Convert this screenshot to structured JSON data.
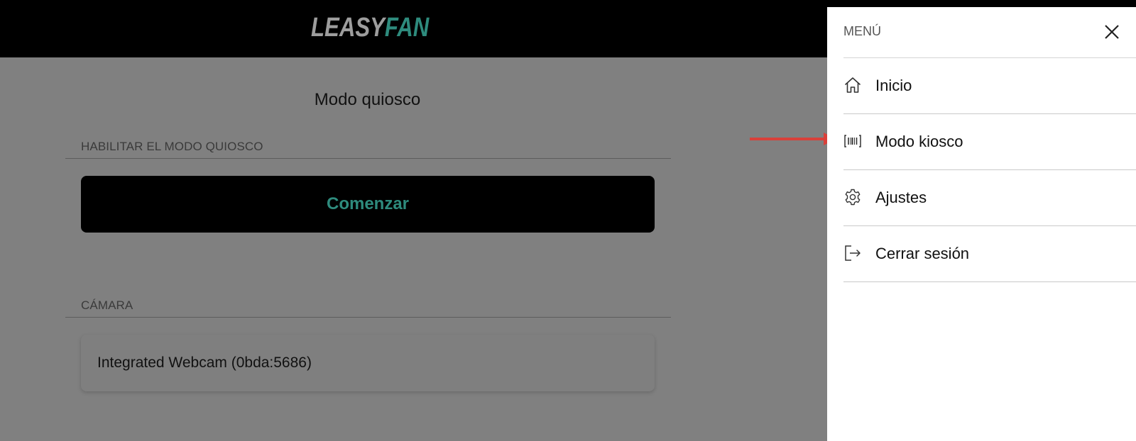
{
  "header": {
    "logo_part1": "LEASY",
    "logo_part2": "FAN",
    "logo_color1": "#9d9d9d",
    "logo_color2": "#2e8b7d"
  },
  "main": {
    "title": "Modo quiosco",
    "kiosk_section_label": "HABILITAR EL MODO QUIOSCO",
    "start_button_label": "Comenzar",
    "camera_section_label": "CÁMARA",
    "camera_value": "Integrated Webcam (0bda:5686)"
  },
  "menu": {
    "title": "MENÚ",
    "close_icon": "close-icon",
    "items": [
      {
        "label": "Inicio",
        "icon": "home-icon"
      },
      {
        "label": "Modo kiosco",
        "icon": "barcode-scan-icon"
      },
      {
        "label": "Ajustes",
        "icon": "gear-icon"
      },
      {
        "label": "Cerrar sesión",
        "icon": "logout-icon"
      }
    ]
  },
  "colors": {
    "accent": "#2e8b7d",
    "annotation_arrow": "#d9403a",
    "overlay": "#808080"
  }
}
